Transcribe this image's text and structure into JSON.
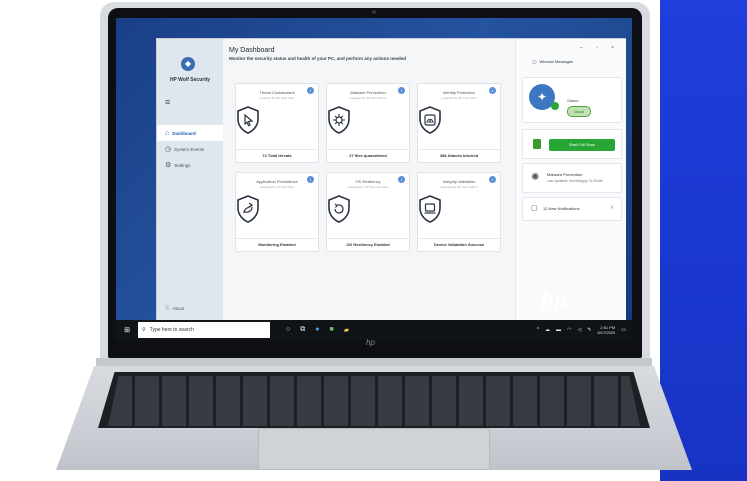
{
  "app": {
    "brand_name": "HP Wolf Security",
    "title": "My Dashboard",
    "subtitle": "Monitor the security status and health of your PC, and perform any actions needed"
  },
  "sidebar": {
    "items": [
      {
        "label": "Dashboard",
        "icon": "home-icon",
        "active": true
      },
      {
        "label": "System Events",
        "icon": "clock-icon",
        "active": false
      },
      {
        "label": "Settings",
        "icon": "gear-icon",
        "active": false
      }
    ],
    "about_label": "About"
  },
  "cards": [
    {
      "title": "Threat Containment",
      "powered": "powered by HP Sure Click",
      "footer": "72 Total threats",
      "icon": "cursor-shield-icon"
    },
    {
      "title": "Malware Prevention",
      "powered": "powered by HP Sure Sense",
      "footer": "27 files quarantined",
      "icon": "virus-shield-icon"
    },
    {
      "title": "Identity Protection",
      "powered": "powered by HP Sure Click",
      "footer": "398 Attacks blocked",
      "icon": "fingerprint-shield-icon"
    },
    {
      "title": "Application Persistence",
      "powered": "powered by HP Sure Run",
      "footer": "Monitoring Enabled",
      "icon": "persistence-shield-icon"
    },
    {
      "title": "OS Resiliency",
      "powered": "powered by HP Sure Recover",
      "footer": "OS Resiliency Enabled",
      "icon": "recovery-shield-icon"
    },
    {
      "title": "Integrity Validation",
      "powered": "powered by HP Sure Admin",
      "footer": "Device Validation Success",
      "icon": "device-shield-icon"
    }
  ],
  "right_panel": {
    "window_messages_label": "Window Messages",
    "status_label": "Status",
    "status_value": "Good",
    "scan_button_label": "Start Full Scan",
    "malware_title": "Malware Prevention",
    "malware_detail": "Last updated: mm/dd/yyyy 11:00AM",
    "notifications_label": "12 New Notifications"
  },
  "taskbar": {
    "search_placeholder": "Type here to search",
    "time": "2:51 PM",
    "date": "5/17/2020"
  },
  "colors": {
    "accent": "#1f5bb5",
    "good": "#27a636",
    "brand_blue": "#1f3fdc"
  }
}
